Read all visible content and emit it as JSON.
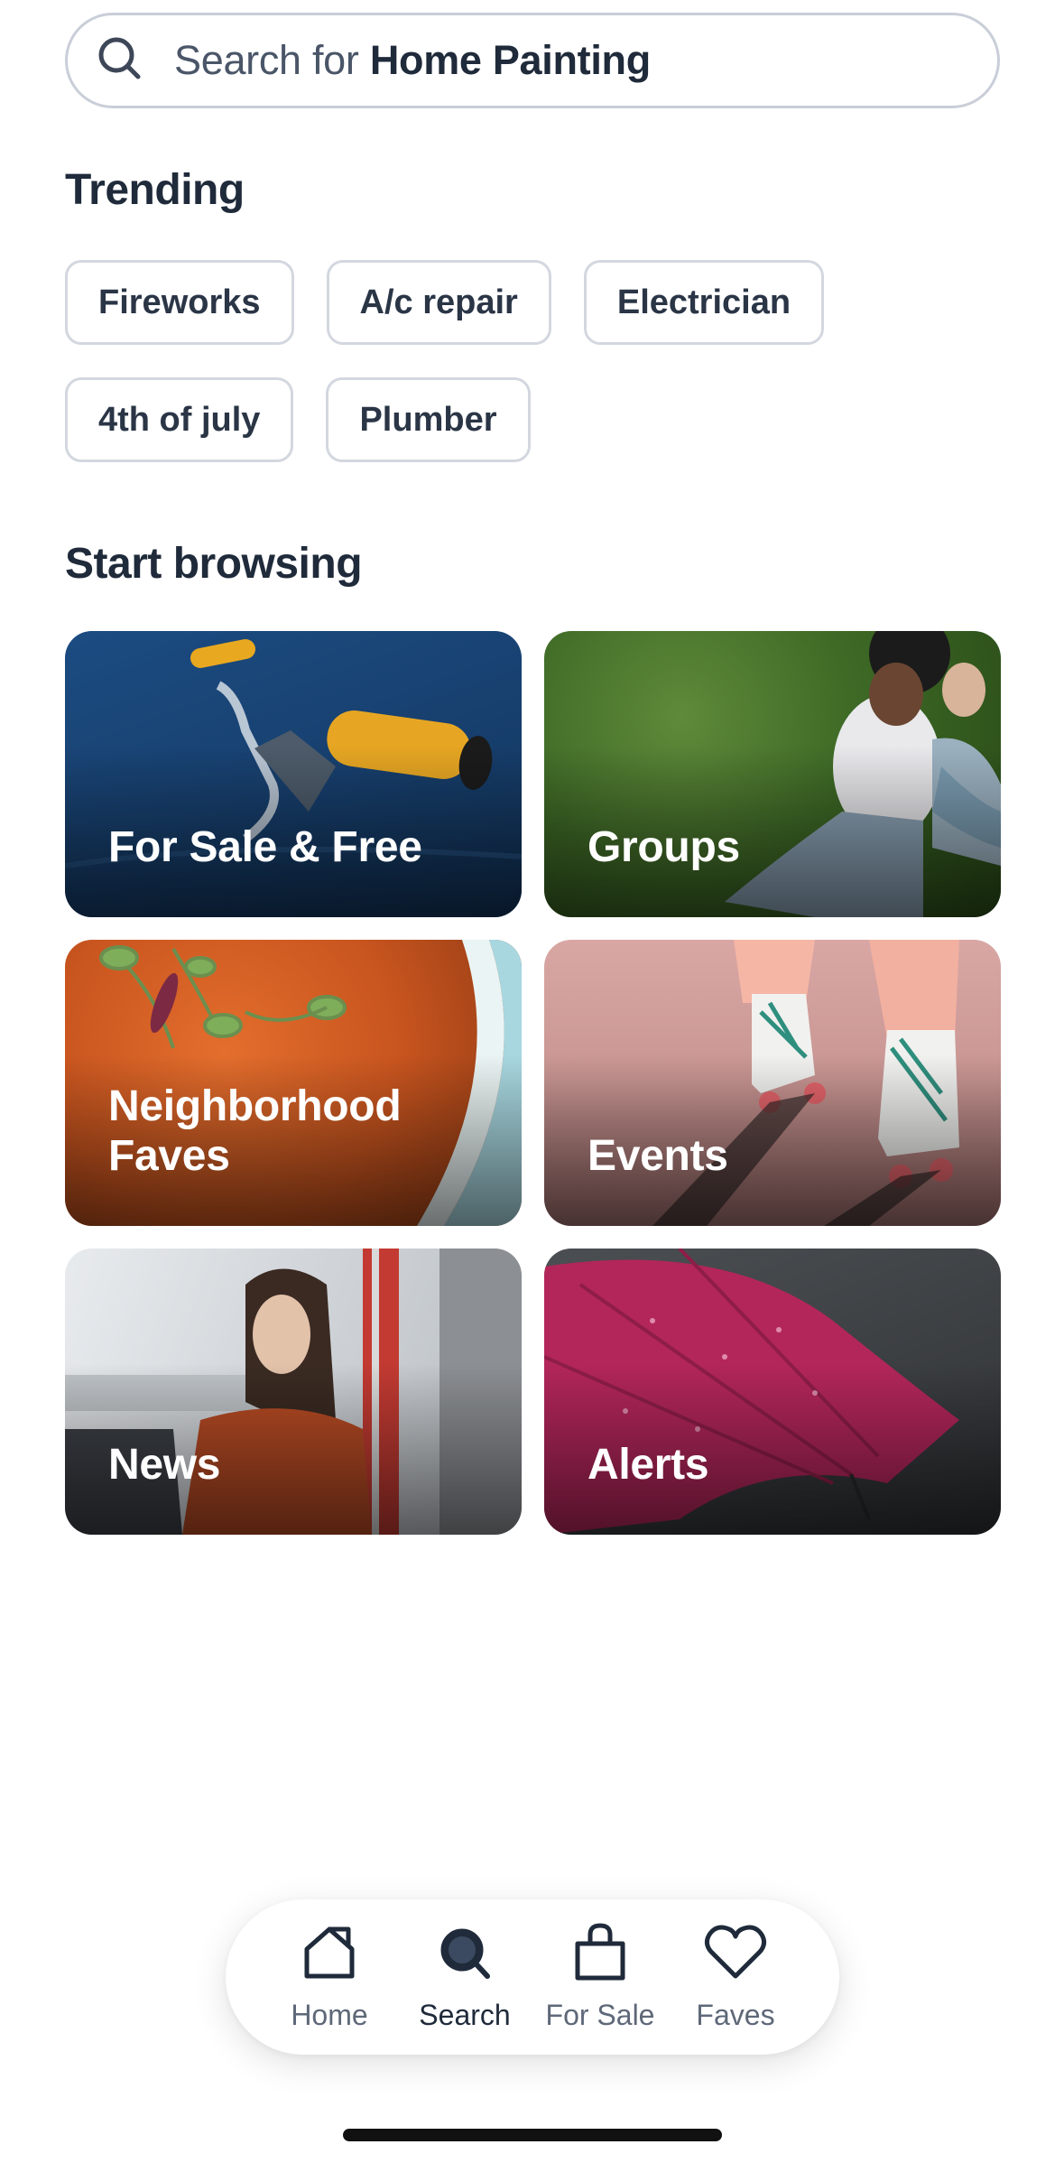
{
  "search": {
    "prefix": "Search for ",
    "term": "Home Painting"
  },
  "trending": {
    "title": "Trending",
    "chips": [
      "Fireworks",
      "A/c repair",
      "Electrician",
      "4th of july",
      "Plumber"
    ]
  },
  "browse": {
    "title": "Start browsing",
    "tiles": [
      {
        "label": "For Sale & Free"
      },
      {
        "label": "Groups"
      },
      {
        "label": "Neighborhood Faves"
      },
      {
        "label": "Events"
      },
      {
        "label": "News"
      },
      {
        "label": "Alerts"
      }
    ]
  },
  "nav": {
    "items": [
      {
        "label": "Home",
        "icon": "home-icon"
      },
      {
        "label": "Search",
        "icon": "search-icon"
      },
      {
        "label": "For Sale",
        "icon": "shopping-bag-icon"
      },
      {
        "label": "Faves",
        "icon": "heart-icon"
      }
    ],
    "active": "Search"
  },
  "colors": {
    "text": "#1f2a3a",
    "chip_border": "#d3d7df",
    "search_border": "#c9ced8"
  }
}
